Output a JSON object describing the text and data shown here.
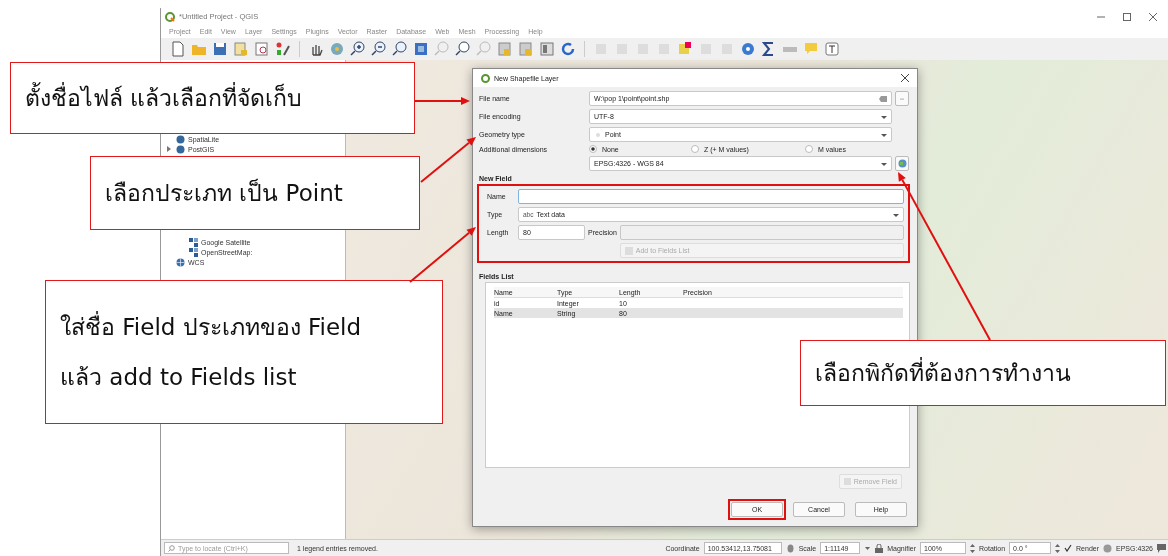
{
  "window": {
    "title": "*Untitled Project - QGIS"
  },
  "menu": [
    "Project",
    "Edit",
    "View",
    "Layer",
    "Settings",
    "Plugins",
    "Vector",
    "Raster",
    "Database",
    "Web",
    "Mesh",
    "Processing",
    "Help"
  ],
  "browser": {
    "items": [
      {
        "label": "SpatiaLite",
        "kind": "db"
      },
      {
        "label": "PostGIS",
        "kind": "db",
        "expanded": false
      },
      {
        "label": "Google Satellite",
        "kind": "xyz"
      },
      {
        "label": "OpenStreetMap:",
        "kind": "xyz"
      },
      {
        "label": "WCS",
        "kind": "service"
      }
    ]
  },
  "dialog": {
    "title": "New Shapefile Layer",
    "file_name": {
      "label": "File name",
      "value": "W:\\pop 1\\point\\point.shp"
    },
    "file_encoding": {
      "label": "File encoding",
      "value": "UTF-8"
    },
    "geometry_type": {
      "label": "Geometry type",
      "value": "Point"
    },
    "additional_dimensions": {
      "label": "Additional dimensions",
      "options": [
        {
          "label": "None",
          "selected": true
        },
        {
          "label": "Z (+ M values)",
          "selected": false
        },
        {
          "label": "M values",
          "selected": false
        }
      ]
    },
    "crs": {
      "value": "EPSG:4326 - WGS 84"
    },
    "new_field": {
      "title": "New Field",
      "name": {
        "label": "Name"
      },
      "type": {
        "label": "Type",
        "prefix": "abc",
        "value": "Text data"
      },
      "length": {
        "label": "Length",
        "value": "80"
      },
      "precision": {
        "label": "Precision"
      },
      "add_button": {
        "label": "Add to Fields List",
        "disabled": true
      }
    },
    "fields_list": {
      "title": "Fields List",
      "columns": [
        "Name",
        "Type",
        "Length",
        "Precision"
      ],
      "rows": [
        {
          "cells": [
            "id",
            "Integer",
            "10"
          ],
          "selected": false
        },
        {
          "cells": [
            "Name",
            "String",
            "80"
          ],
          "selected": true
        }
      ]
    },
    "remove_button": {
      "label": "Remove Field",
      "disabled": true
    },
    "buttons": [
      {
        "label": "OK",
        "highlighted": true
      },
      {
        "label": "Cancel",
        "highlighted": false
      },
      {
        "label": "Help",
        "highlighted": false
      }
    ]
  },
  "status_bar": {
    "locate_placeholder": "Type to locate (Ctrl+K)",
    "message": "1 legend entries removed.",
    "coordinate_label": "Coordinate",
    "coordinate": "100.53412,13.75081",
    "scale_label": "Scale",
    "scale": "1:11149",
    "magnifier_label": "Magnifier",
    "magnifier": "100%",
    "rotation_label": "Rotation",
    "rotation": "0.0 °",
    "render": {
      "label": "Render",
      "checked": true
    },
    "crs": "EPSG:4326"
  },
  "callouts": [
    {
      "lines": [
        "ตั้งชื่อไฟล์ แล้วเลือกที่จัดเก็บ"
      ]
    },
    {
      "lines": [
        "เลือกประเภท เป็น Point"
      ]
    },
    {
      "lines": [
        "ใส่ชื่อ Field ประเภทของ Field",
        "แล้ว add to Fields list"
      ]
    },
    {
      "lines": [
        "เลือกพิกัดที่ต้องการทำงาน"
      ]
    }
  ]
}
